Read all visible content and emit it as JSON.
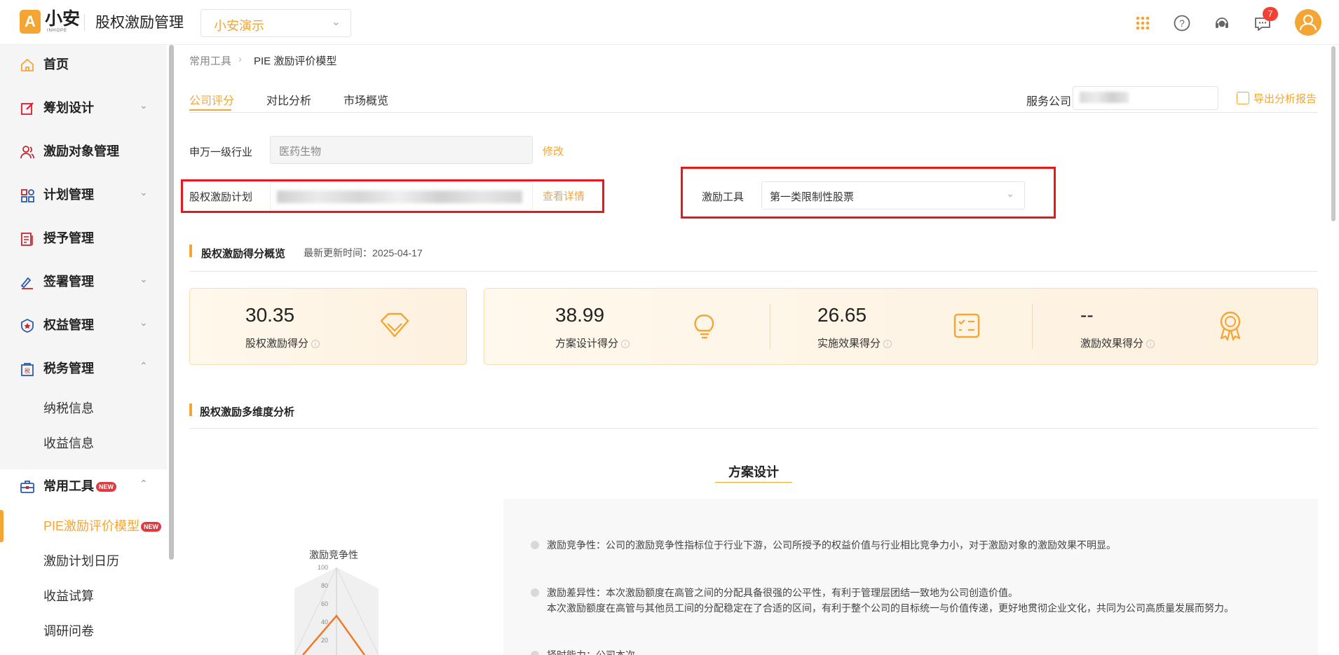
{
  "header": {
    "logo_text": "小安",
    "logo_sub": "INHOPE",
    "app_title": "股权激励管理",
    "company_selected": "小安演示",
    "notification_count": "7"
  },
  "sidebar": {
    "items": [
      {
        "label": "首页"
      },
      {
        "label": "筹划设计"
      },
      {
        "label": "激励对象管理"
      },
      {
        "label": "计划管理"
      },
      {
        "label": "授予管理"
      },
      {
        "label": "签署管理"
      },
      {
        "label": "权益管理"
      },
      {
        "label": "税务管理"
      },
      {
        "label": "常用工具"
      }
    ],
    "tax_sub": [
      {
        "label": "纳税信息"
      },
      {
        "label": "收益信息"
      }
    ],
    "tools_sub": [
      {
        "label": "PIE激励评价模型"
      },
      {
        "label": "激励计划日历"
      },
      {
        "label": "收益试算"
      },
      {
        "label": "调研问卷"
      }
    ],
    "new_badge": "NEW"
  },
  "breadcrumb": {
    "parent": "常用工具",
    "current": "PIE 激励评价模型"
  },
  "tabs": [
    {
      "label": "公司评分"
    },
    {
      "label": "对比分析"
    },
    {
      "label": "市场概览"
    }
  ],
  "service": {
    "label": "服务公司",
    "export_label": "导出分析报告"
  },
  "form": {
    "industry_label": "申万一级行业",
    "industry_value": "医药生物",
    "edit_label": "修改",
    "plan_label": "股权激励计划",
    "detail_label": "查看详情",
    "tool_label": "激励工具",
    "tool_value": "第一类限制性股票"
  },
  "overview": {
    "title": "股权激励得分概览",
    "updated": "最新更新时间：2025-04-17",
    "scores": [
      {
        "value": "30.35",
        "label": "股权激励得分"
      },
      {
        "value": "38.99",
        "label": "方案设计得分"
      },
      {
        "value": "26.65",
        "label": "实施效果得分"
      },
      {
        "value": "--",
        "label": "激励效果得分"
      }
    ]
  },
  "analysis": {
    "title": "股权激励多维度分析",
    "panel_title": "方案设计",
    "radar_axis_label": "激励竞争性",
    "radar_ticks": [
      "100",
      "80",
      "60",
      "40",
      "20"
    ],
    "descriptions": [
      "激励竞争性：公司的激励竞争性指标位于行业下游，公司所授予的权益价值与行业相比竞争力小，对于激励对象的激励效果不明显。",
      "激励差异性：本次激励额度在高管之间的分配具备很强的公平性，有利于管理层团结一致地为公司创造价值。",
      "本次激励额度在高管与其他员工间的分配稳定在了合适的区间，有利于整个公司的目标统一与价值传递，更好地贯彻企业文化，共同为公司高质量发展而努力。",
      "择时能力：公司本次，..."
    ]
  },
  "colors": {
    "accent": "#f5a534",
    "highlight_box": "#e8171b",
    "new_badge": "#e03a3e"
  }
}
